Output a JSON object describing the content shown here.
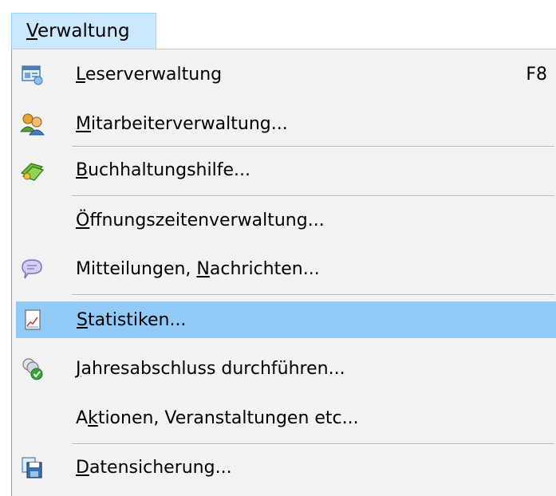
{
  "menubar": {
    "menu": {
      "prefix": "",
      "accel": "V",
      "suffix": "erwaltung"
    }
  },
  "dropdown": {
    "items": [
      {
        "icon": "reader-management-icon",
        "pre": "",
        "accel": "L",
        "post": "eserverwaltung",
        "shortcut": "F8"
      },
      {
        "icon": "staff-people-icon",
        "pre": "",
        "accel": "M",
        "post": "itarbeiterverwaltung..."
      },
      {
        "icon": "money-accounting-icon",
        "pre": "",
        "accel": "B",
        "post": "uchhaltungshilfe..."
      },
      {
        "icon": "",
        "pre": "",
        "accel": "Ö",
        "post": "ffnungszeitenverwaltung..."
      },
      {
        "icon": "speech-bubble-icon",
        "pre": "Mitteilungen, ",
        "accel": "N",
        "post": "achrichten..."
      },
      {
        "icon": "statistics-chart-icon",
        "pre": "",
        "accel": "S",
        "post": "tatistiken...",
        "highlighted": true
      },
      {
        "icon": "year-end-closing-icon",
        "pre": "",
        "accel": "J",
        "post": "ahresabschluss durchführen..."
      },
      {
        "icon": "",
        "pre": "A",
        "accel": "k",
        "post": "tionen, Veranstaltungen etc..."
      },
      {
        "icon": "data-backup-icon",
        "pre": "",
        "accel": "D",
        "post": "atensicherung..."
      }
    ]
  },
  "colors": {
    "menu_background": "#f2f2f2",
    "highlight": "#91c9f7",
    "menubar_selected": "#cce8ff",
    "separator": "#b5b5b5"
  }
}
